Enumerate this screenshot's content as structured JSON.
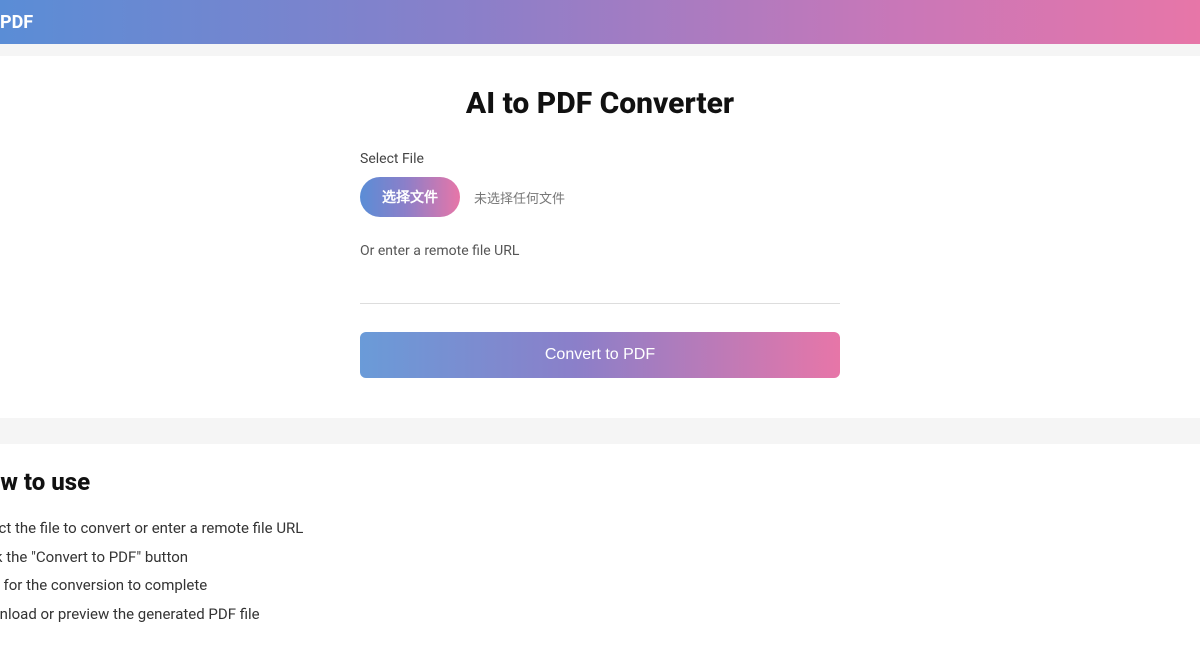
{
  "header": {
    "brand": "PDF"
  },
  "converter": {
    "title": "AI to PDF Converter",
    "select_label": "Select File",
    "choose_button": "选择文件",
    "file_status": "未选择任何文件",
    "or_label": "Or enter a remote file URL",
    "convert_button": "Convert to PDF"
  },
  "howto": {
    "title": "How to use",
    "steps": [
      "Select the file to convert or enter a remote file URL",
      "Click the \"Convert to PDF\" button",
      "Wait for the conversion to complete",
      "Download or preview the generated PDF file"
    ]
  }
}
